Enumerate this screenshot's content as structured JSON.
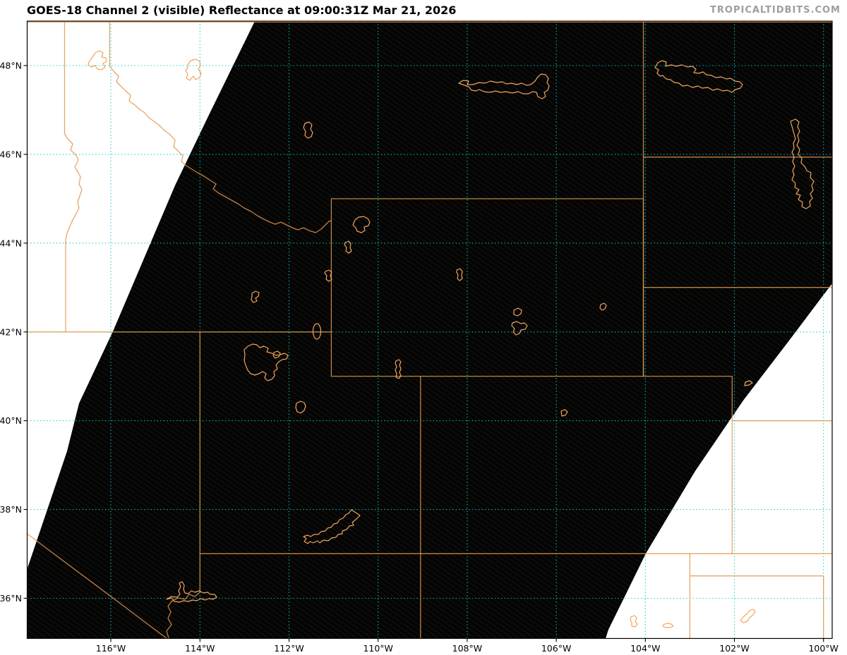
{
  "title": "GOES-18 Channel 2 (visible) Reflectance at 09:00:31Z Mar 21, 2026",
  "watermark": "TROPICALTIDBITS.COM",
  "axes": {
    "lat_ticks": [
      {
        "label": "48°N",
        "value": 48
      },
      {
        "label": "46°N",
        "value": 46
      },
      {
        "label": "44°N",
        "value": 44
      },
      {
        "label": "42°N",
        "value": 42
      },
      {
        "label": "40°N",
        "value": 40
      },
      {
        "label": "38°N",
        "value": 38
      },
      {
        "label": "36°N",
        "value": 36
      }
    ],
    "lon_ticks": [
      {
        "label": "116°W",
        "value": 116
      },
      {
        "label": "114°W",
        "value": 114
      },
      {
        "label": "112°W",
        "value": 112
      },
      {
        "label": "110°W",
        "value": 110
      },
      {
        "label": "108°W",
        "value": 108
      },
      {
        "label": "106°W",
        "value": 106
      },
      {
        "label": "104°W",
        "value": 104
      },
      {
        "label": "102°W",
        "value": 102
      },
      {
        "label": "100°W",
        "value": 100
      }
    ],
    "grid_interval_deg": 2
  },
  "colors": {
    "background": "#ffffff",
    "night_imagery": "#040404",
    "no_data_region": "#ffffff",
    "state_border_orange": "#e2974f",
    "water_outline_orange": "#f2a55c",
    "gridline_cyan": "#00cccc",
    "title_text": "#000000",
    "watermark_gray": "#9e9e9e",
    "axis_frame": "#000000"
  }
}
